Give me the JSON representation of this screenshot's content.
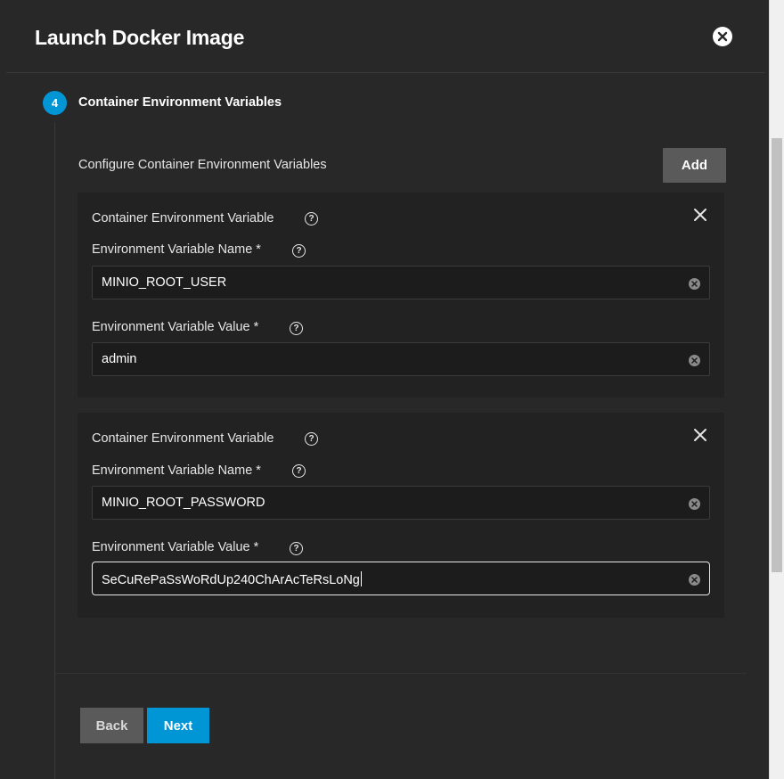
{
  "dialog": {
    "title": "Launch Docker Image",
    "close_icon": "close-circle-icon"
  },
  "step": {
    "number": "4",
    "title": "Container Environment Variables"
  },
  "section": {
    "label": "Configure Container Environment Variables",
    "add_label": "Add"
  },
  "env_vars": [
    {
      "card_title": "Container Environment Variable",
      "name_label": "Environment Variable Name *",
      "name_value": "MINIO_ROOT_USER",
      "value_label": "Environment Variable Value *",
      "value_value": "admin"
    },
    {
      "card_title": "Container Environment Variable",
      "name_label": "Environment Variable Name *",
      "name_value": "MINIO_ROOT_PASSWORD",
      "value_label": "Environment Variable Value *",
      "value_value": "SeCuRePaSsWoRdUp240ChArAcTeRsLoNg"
    }
  ],
  "footer": {
    "back_label": "Back",
    "next_label": "Next"
  },
  "colors": {
    "accent": "#0095d5",
    "dialog_bg": "#282828",
    "card_bg": "#222222",
    "input_bg": "#1c1c1c",
    "secondary_button": "#5a5a5a"
  },
  "icons": {
    "help": "help-circle-icon",
    "remove": "close-x-icon",
    "clear": "clear-circle-icon"
  }
}
